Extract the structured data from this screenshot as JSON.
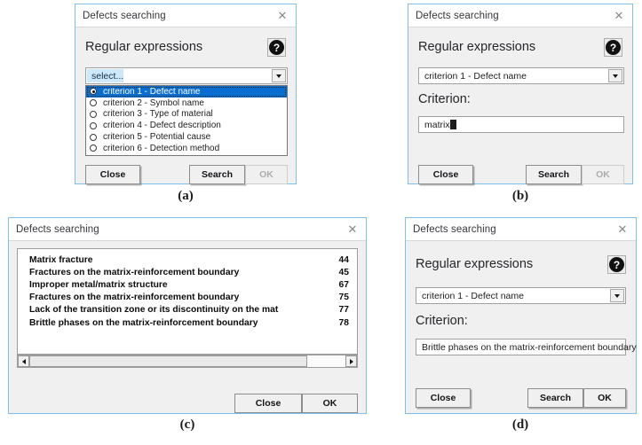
{
  "figure": {
    "captions": {
      "a": "(a)",
      "b": "(b)",
      "c": "(c)",
      "d": "(d)"
    }
  },
  "window": {
    "title": "Defects searching",
    "close_icon": "close-icon",
    "help_icon": "help-question-icon",
    "heading": "Regular expressions",
    "criterion_label": "Criterion:"
  },
  "panel_a": {
    "title": "Defects searching",
    "heading": "Regular expressions",
    "combo_value": "select...",
    "options": [
      {
        "label": "criterion 1 - Defect name",
        "selected": true
      },
      {
        "label": "criterion 2 - Symbol name",
        "selected": false
      },
      {
        "label": "criterion 3 - Type of material",
        "selected": false
      },
      {
        "label": "criterion 4 - Defect description",
        "selected": false
      },
      {
        "label": "criterion 5 - Potential cause",
        "selected": false
      },
      {
        "label": "criterion 6 - Detection method",
        "selected": false
      }
    ],
    "buttons": {
      "close": "Close",
      "search": "Search",
      "ok": "OK",
      "ok_enabled": false
    }
  },
  "panel_b": {
    "title": "Defects searching",
    "heading": "Regular expressions",
    "combo_value": "criterion 1 - Defect name",
    "criterion_label": "Criterion:",
    "criterion_value": "matrix",
    "buttons": {
      "close": "Close",
      "search": "Search",
      "ok": "OK",
      "ok_enabled": false
    }
  },
  "panel_c": {
    "title": "Defects searching",
    "results": [
      {
        "name": "Matrix fracture",
        "id": "44"
      },
      {
        "name": "Fractures on the matrix-reinforcement boundary",
        "id": "45"
      },
      {
        "name": "Improper metal/matrix structure",
        "id": "67"
      },
      {
        "name": "Fractures on the matrix-reinforcement boundary",
        "id": "75"
      },
      {
        "name": "Lack of the transition zone or its discontinuity on the mat",
        "id": "77"
      },
      {
        "name": "Brittle phases on the matrix-reinforcement boundary",
        "id": "78"
      }
    ],
    "buttons": {
      "close": "Close",
      "ok": "OK"
    }
  },
  "panel_d": {
    "title": "Defects searching",
    "heading": "Regular expressions",
    "combo_value": "criterion 1 - Defect name",
    "criterion_label": "Criterion:",
    "criterion_value": "Brittle phases on the matrix-reinforcement boundary",
    "buttons": {
      "close": "Close",
      "search": "Search",
      "ok": "OK",
      "ok_enabled": true
    }
  },
  "colors": {
    "window_border": "#7ec0ea",
    "dialog_bg": "#f0f0f0",
    "selection_blue": "#0a6ed1",
    "combo_selection": "#cde8fa"
  }
}
